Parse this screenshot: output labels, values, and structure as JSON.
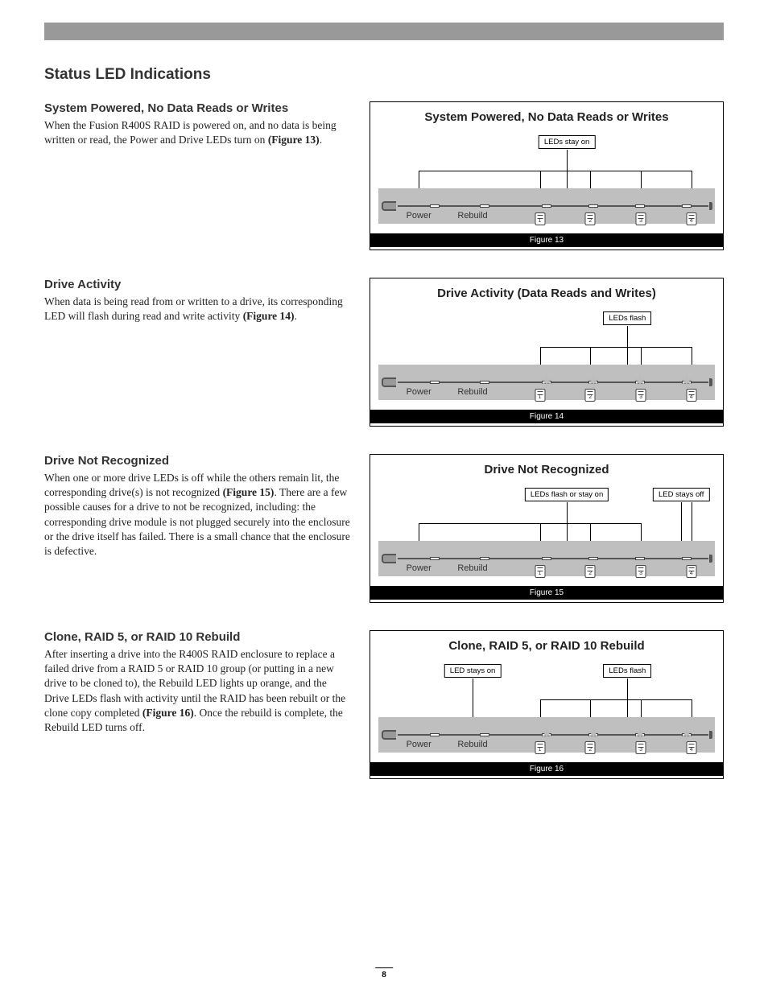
{
  "page_number": "8",
  "main_title": "Status LED Indications",
  "labels": {
    "power": "Power",
    "rebuild": "Rebuild"
  },
  "sections": [
    {
      "heading": "System Powered, No Data Reads or Writes",
      "body_pre": "When the Fusion R400S RAID is powered on, and no data is being written or read, the Power and Drive LEDs turn on ",
      "body_bold": "(Figure 13)",
      "body_post": ".",
      "fig_title": "System Powered, No Data Reads or Writes",
      "fig_caption": "Figure 13",
      "callouts": [
        {
          "text": "LEDs stay on",
          "x": 56
        }
      ]
    },
    {
      "heading": "Drive Activity",
      "body_pre": "When data is being read from or written to a drive, its corresponding LED will flash during read and write activity ",
      "body_bold": "(Figure 14)",
      "body_post": ".",
      "fig_title": "Drive Activity (Data Reads and Writes)",
      "fig_caption": "Figure 14",
      "callouts": [
        {
          "text": "LEDs flash",
          "x": 74
        }
      ]
    },
    {
      "heading": "Drive Not Recognized",
      "body_pre": "When one or more drive LEDs is off while the others remain lit, the corresponding drive(s) is not recognized ",
      "body_bold": "(Figure 15)",
      "body_post": ". There are a few possible causes for a drive to not be recognized, including: the corresponding drive module is not plugged securely into the enclosure or the drive itself has failed. There is a small chance that the enclosure is defective.",
      "fig_title": "Drive Not Recognized",
      "fig_caption": "Figure 15",
      "callouts": [
        {
          "text": "LEDs flash or stay on",
          "x": 56
        },
        {
          "text": "LED stays off",
          "x": 90
        }
      ]
    },
    {
      "heading": "Clone, RAID 5, or RAID 10 Rebuild",
      "body_pre": "After inserting a drive into the R400S RAID enclosure to replace a failed drive from a RAID 5 or RAID 10 group (or putting in a new drive to be cloned to), the Rebuild LED lights up orange, and the Drive LEDs flash with activity until the RAID has been rebuilt or the clone copy completed ",
      "body_bold": "(Figure 16)",
      "body_post": ". Once the rebuild is complete, the Rebuild LED turns off.",
      "fig_title": "Clone, RAID 5, or RAID 10 Rebuild",
      "fig_caption": "Figure 16",
      "callouts": [
        {
          "text": "LED stays on",
          "x": 28
        },
        {
          "text": "LEDs flash",
          "x": 74
        }
      ]
    }
  ],
  "chart_data": [
    {
      "type": "table",
      "title": "System Powered, No Data Reads or Writes",
      "leds": [
        "Power",
        "Rebuild",
        "Drive1",
        "Drive2",
        "Drive3",
        "Drive4"
      ],
      "state": [
        "on",
        "off",
        "on",
        "on",
        "on",
        "on"
      ],
      "annotation": "LEDs stay on"
    },
    {
      "type": "table",
      "title": "Drive Activity (Data Reads and Writes)",
      "leds": [
        "Power",
        "Rebuild",
        "Drive1",
        "Drive2",
        "Drive3",
        "Drive4"
      ],
      "state": [
        "on",
        "off",
        "flash",
        "flash",
        "flash",
        "flash"
      ],
      "annotation": "LEDs flash"
    },
    {
      "type": "table",
      "title": "Drive Not Recognized",
      "leds": [
        "Power",
        "Rebuild",
        "Drive1",
        "Drive2",
        "Drive3",
        "Drive4"
      ],
      "state": [
        "on",
        "off",
        "on",
        "on",
        "on",
        "off"
      ],
      "annotations": [
        "LEDs flash or stay on",
        "LED stays off"
      ]
    },
    {
      "type": "table",
      "title": "Clone, RAID 5, or RAID 10 Rebuild",
      "leds": [
        "Power",
        "Rebuild",
        "Drive1",
        "Drive2",
        "Drive3",
        "Drive4"
      ],
      "state": [
        "on",
        "on",
        "flash",
        "flash",
        "flash",
        "flash"
      ],
      "annotations": [
        "LED stays on",
        "LEDs flash"
      ]
    }
  ]
}
